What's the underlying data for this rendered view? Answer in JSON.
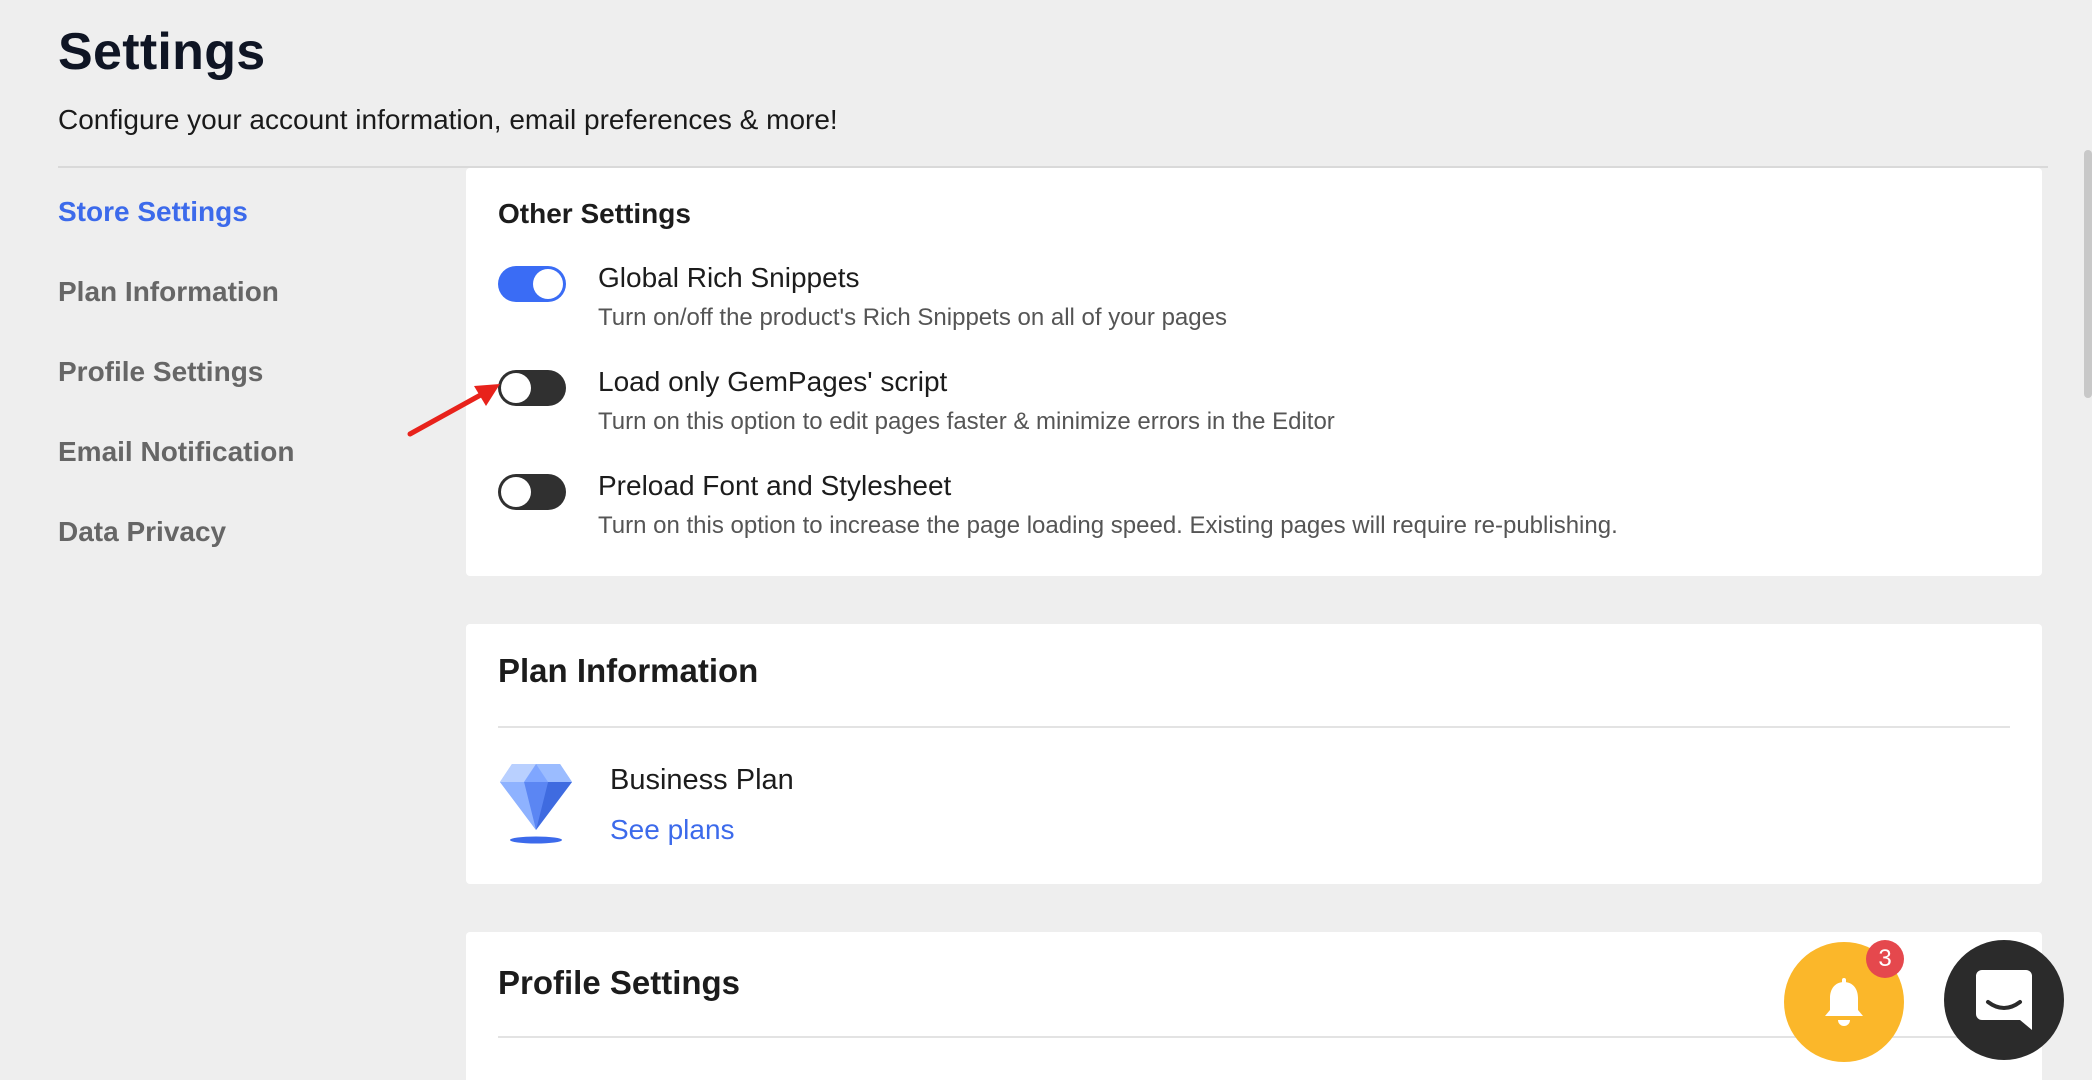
{
  "header": {
    "title": "Settings",
    "subtitle": "Configure your account information, email preferences & more!"
  },
  "sidebar": {
    "items": [
      {
        "label": "Store Settings",
        "active": true
      },
      {
        "label": "Plan Information",
        "active": false
      },
      {
        "label": "Profile Settings",
        "active": false
      },
      {
        "label": "Email Notification",
        "active": false
      },
      {
        "label": "Data Privacy",
        "active": false
      }
    ]
  },
  "other_settings": {
    "title": "Other Settings",
    "items": [
      {
        "title": "Global Rich Snippets",
        "description": "Turn on/off the product's Rich Snippets on all of your pages",
        "enabled": true
      },
      {
        "title": "Load only GemPages' script",
        "description": "Turn on this option to edit pages faster & minimize errors in the Editor",
        "enabled": false
      },
      {
        "title": "Preload Font and Stylesheet",
        "description": "Turn on this option to increase the page loading speed. Existing pages will require re-publishing.",
        "enabled": false
      }
    ]
  },
  "plan_information": {
    "title": "Plan Information",
    "plan_name": "Business Plan",
    "link_label": "See plans",
    "icon": "diamond-icon"
  },
  "profile_settings": {
    "title": "Profile Settings"
  },
  "floating": {
    "notification_count": "3",
    "notification_icon": "bell-icon",
    "chat_icon": "chat-icon"
  },
  "colors": {
    "accent": "#3c6aeb",
    "toggle_on": "#3a6cf5",
    "toggle_off": "#303030",
    "notification_bg": "#fbb72a",
    "badge": "#e5484d",
    "annotation_arrow": "#e8221b"
  }
}
